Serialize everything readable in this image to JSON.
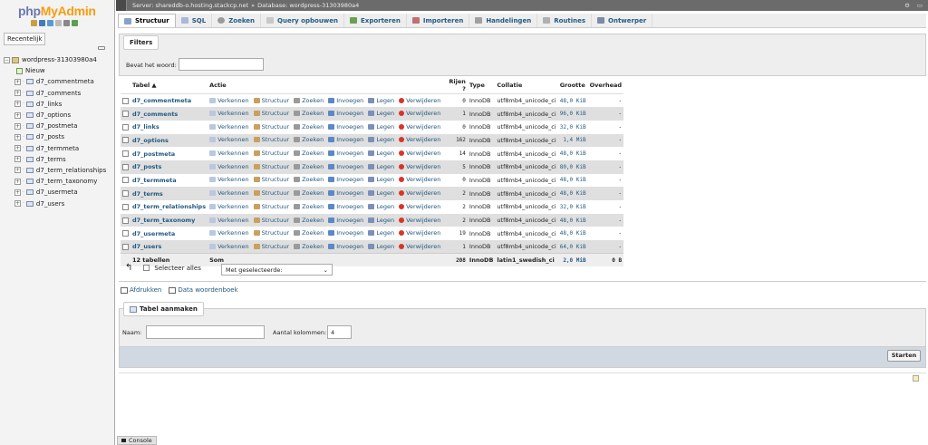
{
  "sidebar": {
    "logo_part1": "php",
    "logo_part2": "MyAdmin",
    "recent_label": "Recentelijk",
    "database": "wordpress-31303980a4",
    "new_label": "Nieuw",
    "tables": [
      "d7_commentmeta",
      "d7_comments",
      "d7_links",
      "d7_options",
      "d7_postmeta",
      "d7_posts",
      "d7_termmeta",
      "d7_terms",
      "d7_term_relationships",
      "d7_term_taxonomy",
      "d7_usermeta",
      "d7_users"
    ]
  },
  "topbar": {
    "server": "Server: shareddb-o.hosting.stackcp.net",
    "separator": "»",
    "database": "Database: wordpress-31303980a4"
  },
  "tabs": [
    "Structuur",
    "SQL",
    "Zoeken",
    "Query opbouwen",
    "Exporteren",
    "Importeren",
    "Handelingen",
    "Routines",
    "Ontwerper"
  ],
  "filters": {
    "legend": "Filters",
    "label": "Bevat het woord:",
    "value": ""
  },
  "table": {
    "headers": [
      "Tabel",
      "Actie",
      "Rijen",
      "Type",
      "Collatie",
      "Grootte",
      "Overhead"
    ],
    "actions": [
      "Verkennen",
      "Structuur",
      "Zoeken",
      "Invoegen",
      "Legen",
      "Verwijderen"
    ],
    "rows": [
      {
        "name": "d7_commentmeta",
        "rows": "0",
        "type": "InnoDB",
        "collation": "utf8mb4_unicode_ci",
        "size": "48,0 KiB",
        "overhead": "-"
      },
      {
        "name": "d7_comments",
        "rows": "1",
        "type": "InnoDB",
        "collation": "utf8mb4_unicode_ci",
        "size": "96,0 KiB",
        "overhead": "-"
      },
      {
        "name": "d7_links",
        "rows": "0",
        "type": "InnoDB",
        "collation": "utf8mb4_unicode_ci",
        "size": "32,0 KiB",
        "overhead": "-"
      },
      {
        "name": "d7_options",
        "rows": "162",
        "type": "InnoDB",
        "collation": "utf8mb4_unicode_ci",
        "size": "1,4 MiB",
        "overhead": "-"
      },
      {
        "name": "d7_postmeta",
        "rows": "14",
        "type": "InnoDB",
        "collation": "utf8mb4_unicode_ci",
        "size": "48,0 KiB",
        "overhead": "-"
      },
      {
        "name": "d7_posts",
        "rows": "5",
        "type": "InnoDB",
        "collation": "utf8mb4_unicode_ci",
        "size": "80,0 KiB",
        "overhead": "-"
      },
      {
        "name": "d7_termmeta",
        "rows": "0",
        "type": "InnoDB",
        "collation": "utf8mb4_unicode_ci",
        "size": "48,0 KiB",
        "overhead": "-"
      },
      {
        "name": "d7_terms",
        "rows": "2",
        "type": "InnoDB",
        "collation": "utf8mb4_unicode_ci",
        "size": "48,0 KiB",
        "overhead": "-"
      },
      {
        "name": "d7_term_relationships",
        "rows": "2",
        "type": "InnoDB",
        "collation": "utf8mb4_unicode_ci",
        "size": "32,0 KiB",
        "overhead": "-"
      },
      {
        "name": "d7_term_taxonomy",
        "rows": "2",
        "type": "InnoDB",
        "collation": "utf8mb4_unicode_ci",
        "size": "48,0 KiB",
        "overhead": "-"
      },
      {
        "name": "d7_usermeta",
        "rows": "19",
        "type": "InnoDB",
        "collation": "utf8mb4_unicode_ci",
        "size": "48,0 KiB",
        "overhead": "-"
      },
      {
        "name": "d7_users",
        "rows": "1",
        "type": "InnoDB",
        "collation": "utf8mb4_unicode_ci",
        "size": "64,0 KiB",
        "overhead": "-"
      }
    ],
    "footer": {
      "name": "12 tabellen",
      "action": "Som",
      "rows": "208",
      "type": "InnoDB",
      "collation": "latin1_swedish_ci",
      "size": "2,0 MiB",
      "overhead": "0 B"
    }
  },
  "bulk": {
    "select_all": "Selecteer alles",
    "with_selected": "Met geselecteerde:"
  },
  "links": {
    "print": "Afdrukken",
    "dictionary": "Data woordenboek"
  },
  "create_table": {
    "legend": "Tabel aanmaken",
    "name_label": "Naam:",
    "name_value": "",
    "columns_label": "Aantal kolommen:",
    "columns_value": "4",
    "submit": "Starten"
  },
  "console": "Console"
}
